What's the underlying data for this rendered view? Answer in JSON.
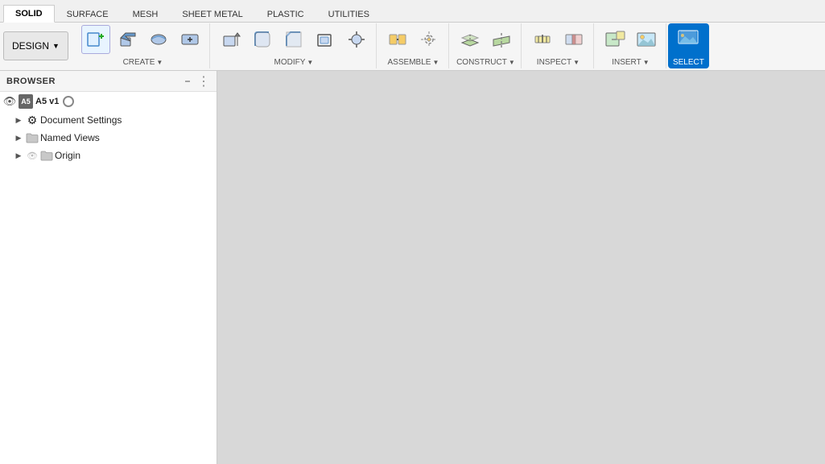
{
  "tabs": [
    {
      "label": "SOLID",
      "active": true
    },
    {
      "label": "SURFACE",
      "active": false
    },
    {
      "label": "MESH",
      "active": false
    },
    {
      "label": "SHEET METAL",
      "active": false
    },
    {
      "label": "PLASTIC",
      "active": false
    },
    {
      "label": "UTILITIES",
      "active": false
    }
  ],
  "toolbar": {
    "design_label": "DESIGN",
    "groups": [
      {
        "name": "CREATE",
        "label": "CREATE",
        "icons": [
          "new-body",
          "extrude",
          "revolve",
          "sweep",
          "loft",
          "box",
          "more-create"
        ]
      },
      {
        "name": "MODIFY",
        "label": "MODIFY",
        "icons": [
          "push-pull",
          "fillet",
          "chamfer",
          "shell",
          "combine",
          "draft",
          "more-modify"
        ]
      },
      {
        "name": "ASSEMBLE",
        "label": "ASSEMBLE",
        "icons": [
          "joint",
          "joint-origin",
          "more-assemble"
        ]
      },
      {
        "name": "CONSTRUCT",
        "label": "CONSTRUCT",
        "icons": [
          "offset-plane",
          "plane-at-angle",
          "more-construct"
        ]
      },
      {
        "name": "INSPECT",
        "label": "INSPECT",
        "icons": [
          "measure",
          "interference",
          "more-inspect"
        ]
      },
      {
        "name": "INSERT",
        "label": "INSERT",
        "icons": [
          "insert-mesh",
          "more-insert"
        ]
      },
      {
        "name": "SELECT",
        "label": "SELECT",
        "icons": [
          "select"
        ]
      }
    ]
  },
  "browser": {
    "title": "BROWSER",
    "items": [
      {
        "type": "root",
        "label": "A5 v1",
        "has_arrow": true,
        "has_eye": true,
        "has_record": true
      },
      {
        "type": "item",
        "label": "Document Settings",
        "indent": 1,
        "has_arrow": true,
        "has_gear": true
      },
      {
        "type": "item",
        "label": "Named Views",
        "indent": 1,
        "has_arrow": true
      },
      {
        "type": "item",
        "label": "Origin",
        "indent": 1,
        "has_arrow": true,
        "has_eye": true,
        "hidden": true
      }
    ]
  },
  "construct_tooltip": "CONSTRUCT >",
  "canvas": {
    "background": "#e0e0e0"
  }
}
